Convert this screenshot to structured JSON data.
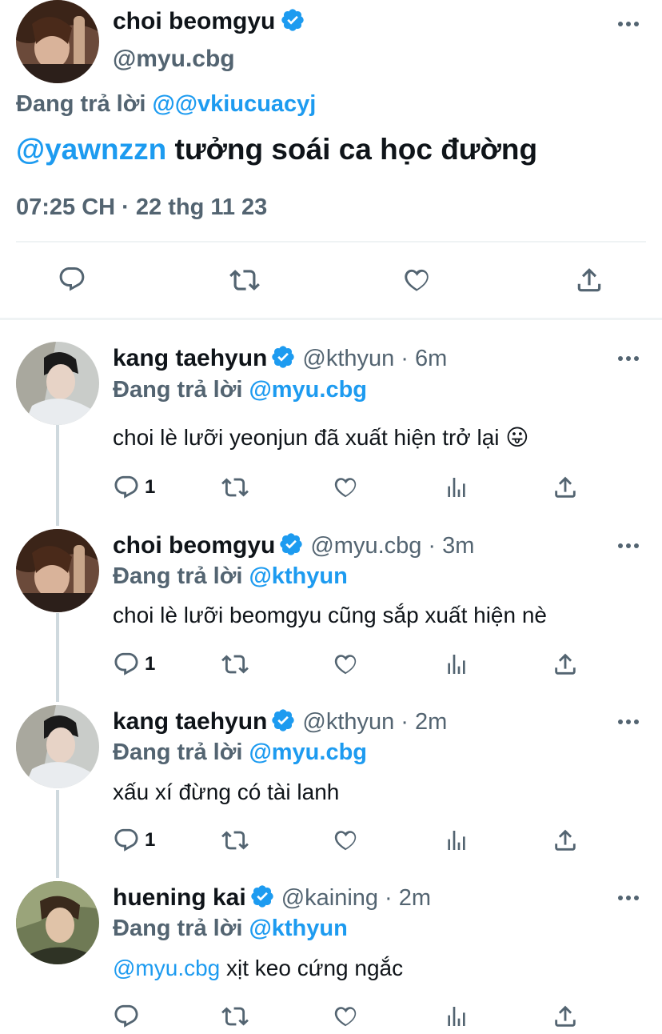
{
  "main_tweet": {
    "display_name": "choi beomgyu",
    "handle": "@myu.cbg",
    "replying_prefix": "Đang trả lời",
    "replying_to": "@@vkiucuacyj",
    "mention": "@yawnzzn",
    "text": "tưởng soái ca học đường",
    "timestamp": "07:25 CH · 22 thg 11 23",
    "actions": [
      "reply-icon",
      "retweet-icon",
      "like-icon",
      "share-icon"
    ]
  },
  "replies": [
    {
      "display_name": "kang taehyun",
      "handle": "@kthyun",
      "time": "· 6m",
      "replying_prefix": "Đang trả lời",
      "replying_to": "@myu.cbg",
      "mention": "",
      "text": "choi lè lưỡi yeonjun đã xuất hiện trở lại",
      "emoji": "😛",
      "reply_count": "1"
    },
    {
      "display_name": "choi beomgyu",
      "handle": "@myu.cbg",
      "time": "· 3m",
      "replying_prefix": "Đang trả lời",
      "replying_to": "@kthyun",
      "mention": "",
      "text": "choi lè lưỡi beomgyu cũng sắp xuất hiện nè",
      "emoji": "",
      "reply_count": "1"
    },
    {
      "display_name": "kang taehyun",
      "handle": "@kthyun",
      "time": "· 2m",
      "replying_prefix": "Đang trả lời",
      "replying_to": "@myu.cbg",
      "mention": "",
      "text": "xấu xí đừng có tài lanh",
      "emoji": "",
      "reply_count": "1"
    },
    {
      "display_name": "huening kai",
      "handle": "@kaining",
      "time": "· 2m",
      "replying_prefix": "Đang trả lời",
      "replying_to": "@kthyun",
      "mention": "@myu.cbg",
      "text": "xịt keo cứng ngắc",
      "emoji": "",
      "reply_count": ""
    }
  ],
  "colors": {
    "accent": "#1d9bf0",
    "secondary_text": "#536471",
    "primary_text": "#0f1419",
    "divider": "#eff3f4"
  }
}
